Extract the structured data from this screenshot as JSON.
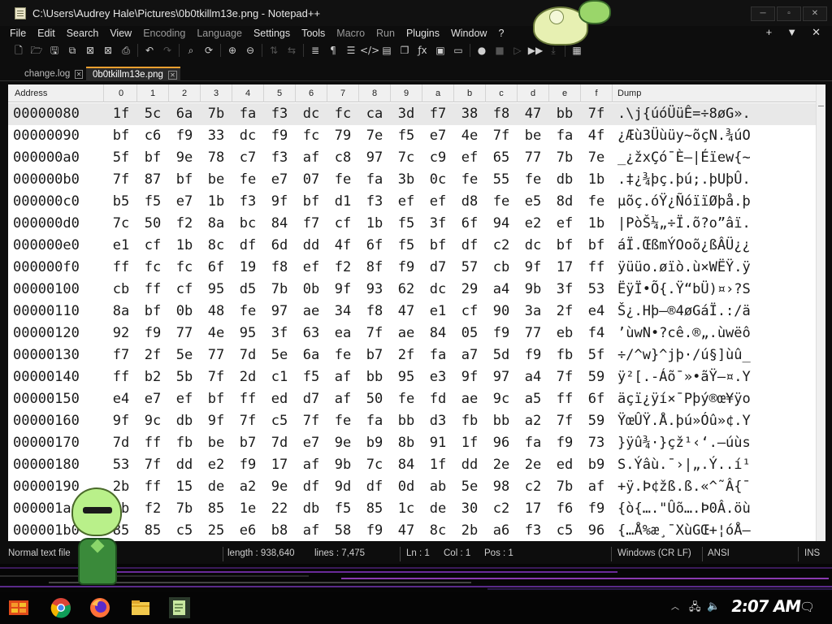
{
  "window": {
    "title": "C:\\Users\\Audrey Hale\\Pictures\\0b0tkillm13e.png - Notepad++",
    "controls": [
      "─",
      "▫",
      "✕"
    ]
  },
  "menu": {
    "items": [
      "File",
      "Edit",
      "Search",
      "View",
      "Encoding",
      "Language",
      "Settings",
      "Tools",
      "Macro",
      "Run",
      "Plugins",
      "Window",
      "?"
    ],
    "right": [
      "+",
      "▼",
      "✕"
    ]
  },
  "toolbar": {
    "icons": [
      "new-file-icon",
      "open-file-icon",
      "save-icon",
      "save-all-icon",
      "close-icon",
      "close-all-icon",
      "print-icon",
      "undo-icon",
      "redo-icon",
      "find-icon",
      "replace-icon",
      "zoom-in-icon",
      "zoom-out-icon",
      "sync-v-icon",
      "sync-h-icon",
      "word-wrap-icon",
      "show-all-chars-icon",
      "indent-guide-icon",
      "lang-icon",
      "doc-map-icon",
      "doc-list-icon",
      "function-list-icon",
      "folder-workspace-icon",
      "monitor-icon",
      "record-macro-icon",
      "stop-macro-icon",
      "play-macro-icon",
      "run-macro-icon",
      "save-macro-icon",
      "hex-icon"
    ]
  },
  "tabs": [
    {
      "label": "change.log",
      "active": false
    },
    {
      "label": "0b0tkillm13e.png",
      "active": true
    }
  ],
  "hex": {
    "header": {
      "address": "Address",
      "columns": [
        "0",
        "1",
        "2",
        "3",
        "4",
        "5",
        "6",
        "7",
        "8",
        "9",
        "a",
        "b",
        "c",
        "d",
        "e",
        "f"
      ],
      "dump": "Dump"
    },
    "rows": [
      {
        "addr": "00000080",
        "bytes": [
          "1f",
          "5c",
          "6a",
          "7b",
          "fa",
          "f3",
          "dc",
          "fc",
          "ca",
          "3d",
          "f7",
          "38",
          "f8",
          "47",
          "bb",
          "7f"
        ],
        "dump": ".\\j{úóÜüÊ=÷8øG»."
      },
      {
        "addr": "00000090",
        "bytes": [
          "bf",
          "c6",
          "f9",
          "33",
          "dc",
          "f9",
          "fc",
          "79",
          "7e",
          "f5",
          "e7",
          "4e",
          "7f",
          "be",
          "fa",
          "4f"
        ],
        "dump": "¿Æù3Üùüy~õçN.¾úO"
      },
      {
        "addr": "000000a0",
        "bytes": [
          "5f",
          "bf",
          "9e",
          "78",
          "c7",
          "f3",
          "af",
          "c8",
          "97",
          "7c",
          "c9",
          "ef",
          "65",
          "77",
          "7b",
          "7e"
        ],
        "dump": "_¿žxÇó¯È—|Éïew{~"
      },
      {
        "addr": "000000b0",
        "bytes": [
          "7f",
          "87",
          "bf",
          "be",
          "fe",
          "e7",
          "07",
          "fe",
          "fa",
          "3b",
          "0c",
          "fe",
          "55",
          "fe",
          "db",
          "1b"
        ],
        "dump": ".‡¿¾þç.þú;.þUþÛ."
      },
      {
        "addr": "000000c0",
        "bytes": [
          "b5",
          "f5",
          "e7",
          "1b",
          "f3",
          "9f",
          "bf",
          "d1",
          "f3",
          "ef",
          "ef",
          "d8",
          "fe",
          "e5",
          "8d",
          "fe"
        ],
        "dump": "µõç.óŸ¿ÑóïïØþå.þ"
      },
      {
        "addr": "000000d0",
        "bytes": [
          "7c",
          "50",
          "f2",
          "8a",
          "bc",
          "84",
          "f7",
          "cf",
          "1b",
          "f5",
          "3f",
          "6f",
          "94",
          "e2",
          "ef",
          "1b"
        ],
        "dump": "|PòŠ¼„÷Ï.õ?o”âï."
      },
      {
        "addr": "000000e0",
        "bytes": [
          "e1",
          "cf",
          "1b",
          "8c",
          "df",
          "6d",
          "dd",
          "4f",
          "6f",
          "f5",
          "bf",
          "df",
          "c2",
          "dc",
          "bf",
          "bf"
        ],
        "dump": "áÏ.ŒßmÝOoõ¿ßÂÜ¿¿"
      },
      {
        "addr": "000000f0",
        "bytes": [
          "ff",
          "fc",
          "fc",
          "6f",
          "19",
          "f8",
          "ef",
          "f2",
          "8f",
          "f9",
          "d7",
          "57",
          "cb",
          "9f",
          "17",
          "ff"
        ],
        "dump": "ÿüüo.øïò.ù×WËŸ.ÿ"
      },
      {
        "addr": "00000100",
        "bytes": [
          "cb",
          "ff",
          "cf",
          "95",
          "d5",
          "7b",
          "0b",
          "9f",
          "93",
          "62",
          "dc",
          "29",
          "a4",
          "9b",
          "3f",
          "53"
        ],
        "dump": "ËÿÏ•Õ{.Ÿ“bÜ)¤›?S"
      },
      {
        "addr": "00000110",
        "bytes": [
          "8a",
          "bf",
          "0b",
          "48",
          "fe",
          "97",
          "ae",
          "34",
          "f8",
          "47",
          "e1",
          "cf",
          "90",
          "3a",
          "2f",
          "e4"
        ],
        "dump": "Š¿.Hþ—®4øGáÏ.:/ä"
      },
      {
        "addr": "00000120",
        "bytes": [
          "92",
          "f9",
          "77",
          "4e",
          "95",
          "3f",
          "63",
          "ea",
          "7f",
          "ae",
          "84",
          "05",
          "f9",
          "77",
          "eb",
          "f4"
        ],
        "dump": "’ùwN•?cê.®„.ùwëô"
      },
      {
        "addr": "00000130",
        "bytes": [
          "f7",
          "2f",
          "5e",
          "77",
          "7d",
          "5e",
          "6a",
          "fe",
          "b7",
          "2f",
          "fa",
          "a7",
          "5d",
          "f9",
          "fb",
          "5f"
        ],
        "dump": "÷/^w}^jþ·/ú§]ùû_"
      },
      {
        "addr": "00000140",
        "bytes": [
          "ff",
          "b2",
          "5b",
          "7f",
          "2d",
          "c1",
          "f5",
          "af",
          "bb",
          "95",
          "e3",
          "9f",
          "97",
          "a4",
          "7f",
          "59"
        ],
        "dump": "ÿ²[.-Áõ¯»•ãŸ—¤.Y"
      },
      {
        "addr": "00000150",
        "bytes": [
          "e4",
          "e7",
          "ef",
          "bf",
          "ff",
          "ed",
          "d7",
          "af",
          "50",
          "fe",
          "fd",
          "ae",
          "9c",
          "a5",
          "ff",
          "6f"
        ],
        "dump": "äçï¿ÿí×¯Pþý®œ¥ÿo"
      },
      {
        "addr": "00000160",
        "bytes": [
          "9f",
          "9c",
          "db",
          "9f",
          "7f",
          "c5",
          "7f",
          "fe",
          "fa",
          "bb",
          "d3",
          "fb",
          "bb",
          "a2",
          "7f",
          "59"
        ],
        "dump": "ŸœÛŸ.Å.þú»Óû»¢.Y"
      },
      {
        "addr": "00000170",
        "bytes": [
          "7d",
          "ff",
          "fb",
          "be",
          "b7",
          "7d",
          "e7",
          "9e",
          "b9",
          "8b",
          "91",
          "1f",
          "96",
          "fa",
          "f9",
          "73"
        ],
        "dump": "}ÿû¾·}çž¹‹‘.–úùs"
      },
      {
        "addr": "00000180",
        "bytes": [
          "53",
          "7f",
          "dd",
          "e2",
          "f9",
          "17",
          "af",
          "9b",
          "7c",
          "84",
          "1f",
          "dd",
          "2e",
          "2e",
          "ed",
          "b9"
        ],
        "dump": "S.Ýâù.¯›|„.Ý..í¹"
      },
      {
        "addr": "00000190",
        "bytes": [
          "2b",
          "ff",
          "15",
          "de",
          "a2",
          "9e",
          "df",
          "9d",
          "df",
          "0d",
          "ab",
          "5e",
          "98",
          "c2",
          "7b",
          "af"
        ],
        "dump": "+ÿ.Þ¢žß.ß.«^˜Â{¯"
      },
      {
        "addr": "000001a0",
        "bytes": [
          "7b",
          "f2",
          "7b",
          "85",
          "1e",
          "22",
          "db",
          "f5",
          "85",
          "1c",
          "de",
          "30",
          "c2",
          "17",
          "f6",
          "f9"
        ],
        "dump": "{ò{….\"Ûõ….Þ0Â.öù"
      },
      {
        "addr": "000001b0",
        "bytes": [
          "85",
          "85",
          "c5",
          "25",
          "e6",
          "b8",
          "af",
          "58",
          "f9",
          "47",
          "8c",
          "2b",
          "a6",
          "f3",
          "c5",
          "96"
        ],
        "dump": "{…Å%æ¸¯XùGŒ+¦óÅ–"
      }
    ]
  },
  "status": {
    "file_type": "Normal text file",
    "length": "length : 938,640",
    "lines": "lines : 7,475",
    "ln": "Ln : 1",
    "col": "Col : 1",
    "pos": "Pos : 1",
    "eol": "Windows (CR LF)",
    "encoding": "ANSI",
    "mode": "INS"
  },
  "taskbar": {
    "clock": "2:07 AM",
    "pinned": [
      "start-icon",
      "chrome-icon",
      "firefox-icon",
      "file-explorer-icon",
      "notepadpp-icon"
    ]
  }
}
